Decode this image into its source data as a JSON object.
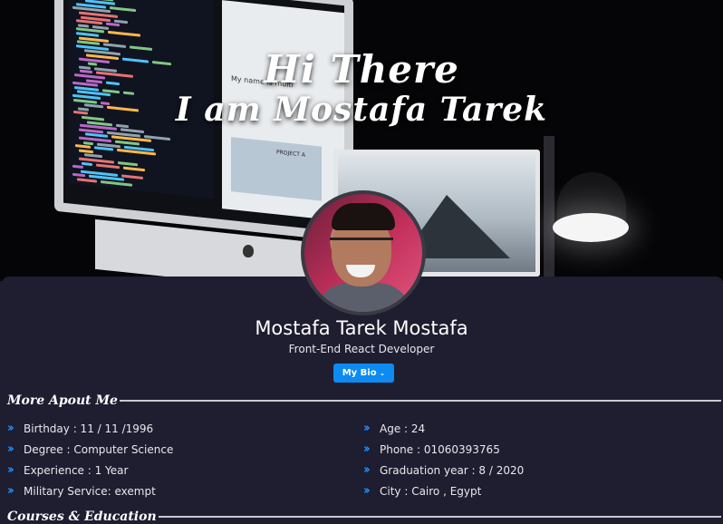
{
  "hero": {
    "line1": "Hi There",
    "line2": "I am Mostafa Tarek",
    "screen_text": "My name is\nmulti",
    "project_label": "PROJECT A"
  },
  "profile": {
    "name": "Mostafa Tarek Mostafa",
    "role": "Front-End React Developer",
    "bio_button": "My Bio",
    "bio_button_icon": "chevron-down-icon"
  },
  "sections": {
    "about_title": "More Apout Me",
    "courses_title": "Courses & Education"
  },
  "about": {
    "left": [
      "Birthday : 11 / 11 /1996",
      "Degree : Computer Science",
      "Experience : 1 Year",
      "Military Service: exempt"
    ],
    "right": [
      "Age : 24",
      "Phone : 01060393765",
      "Graduation year : 8 / 2020",
      "City : Cairo , Egypt"
    ],
    "bullet_icon": "double-chevron-right-icon"
  },
  "colors": {
    "background": "#1f1d30",
    "accent": "#0d8bf0",
    "bullet": "#1e90ff"
  }
}
